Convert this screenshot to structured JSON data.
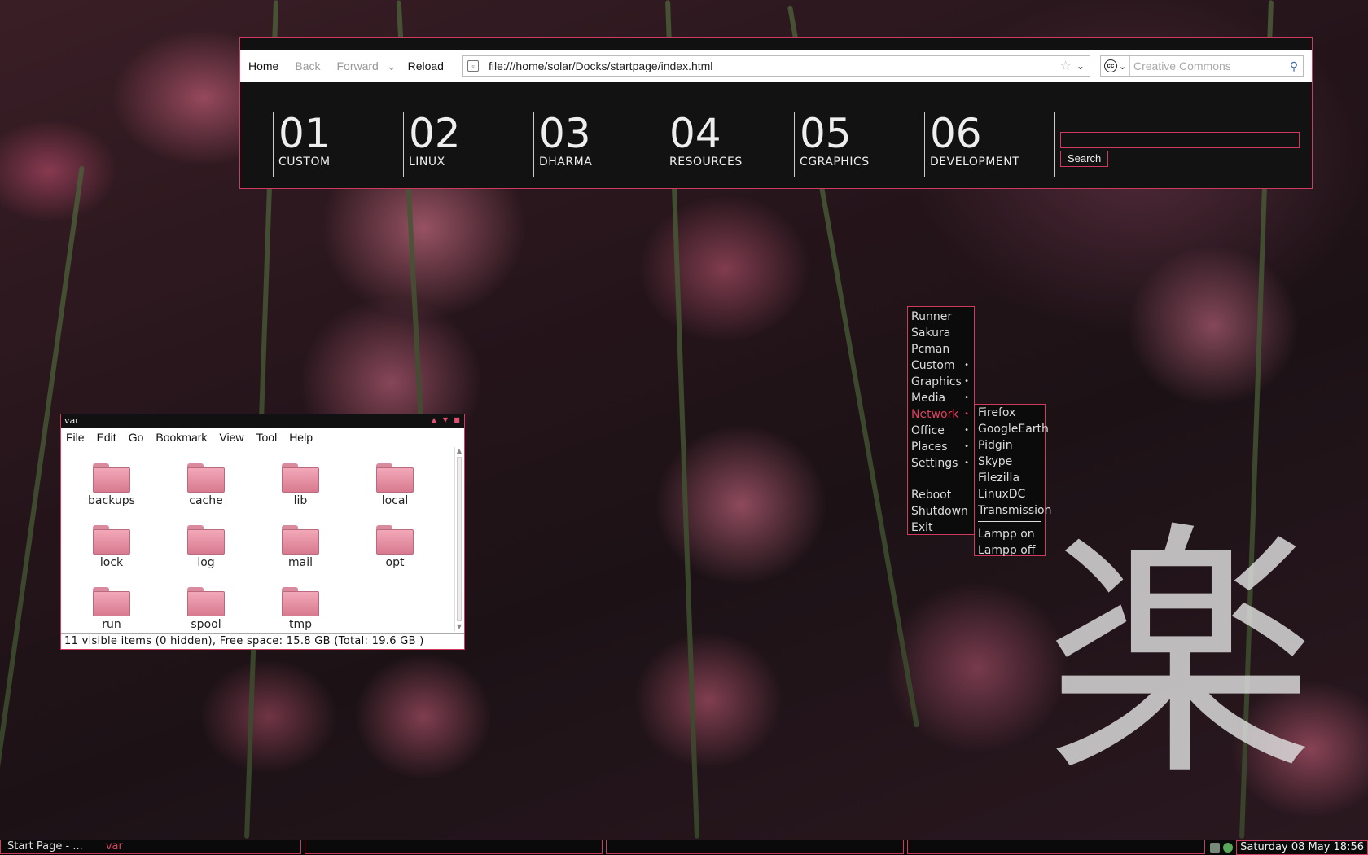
{
  "wallpaper": {
    "kanji": "楽"
  },
  "browser": {
    "toolbar": {
      "home": "Home",
      "back": "Back",
      "forward": "Forward",
      "reload": "Reload",
      "url": "file:///home/solar/Docks/startpage/index.html",
      "search_placeholder": "Creative Commons"
    },
    "tiles": [
      {
        "num": "01",
        "label": "CUSTOM"
      },
      {
        "num": "02",
        "label": "LINUX"
      },
      {
        "num": "03",
        "label": "DHARMA"
      },
      {
        "num": "04",
        "label": "RESOURCES"
      },
      {
        "num": "05",
        "label": "CGRAPHICS"
      },
      {
        "num": "06",
        "label": "DEVELOPMENT"
      }
    ],
    "search_button": "Search"
  },
  "menu": {
    "items": [
      "Runner",
      "Sakura",
      "Pcman",
      "Custom",
      "Graphics",
      "Media",
      "Network",
      "Office",
      "Places",
      "Settings",
      "Reboot",
      "Shutdown",
      "Exit"
    ],
    "active": "Network",
    "submenu": [
      "Firefox",
      "GoogleEarth",
      "Pidgin",
      "Skype",
      "Filezilla",
      "LinuxDC",
      "Transmission",
      "Lampp on",
      "Lampp off"
    ]
  },
  "file_manager": {
    "title": "var",
    "menu": [
      "File",
      "Edit",
      "Go",
      "Bookmark",
      "View",
      "Tool",
      "Help"
    ],
    "items": [
      "backups",
      "cache",
      "lib",
      "local",
      "lock",
      "log",
      "mail",
      "opt",
      "run",
      "spool",
      "tmp"
    ],
    "status": "11 visible items (0 hidden), Free space: 15.8 GB (Total: 19.6 GB )"
  },
  "taskbar": {
    "task1": "Start Page - ...",
    "task1_active": "var",
    "clock": "Saturday 08 May 18:56"
  },
  "colors": {
    "accent": "#d03a5e",
    "active_text": "#e0405e"
  }
}
